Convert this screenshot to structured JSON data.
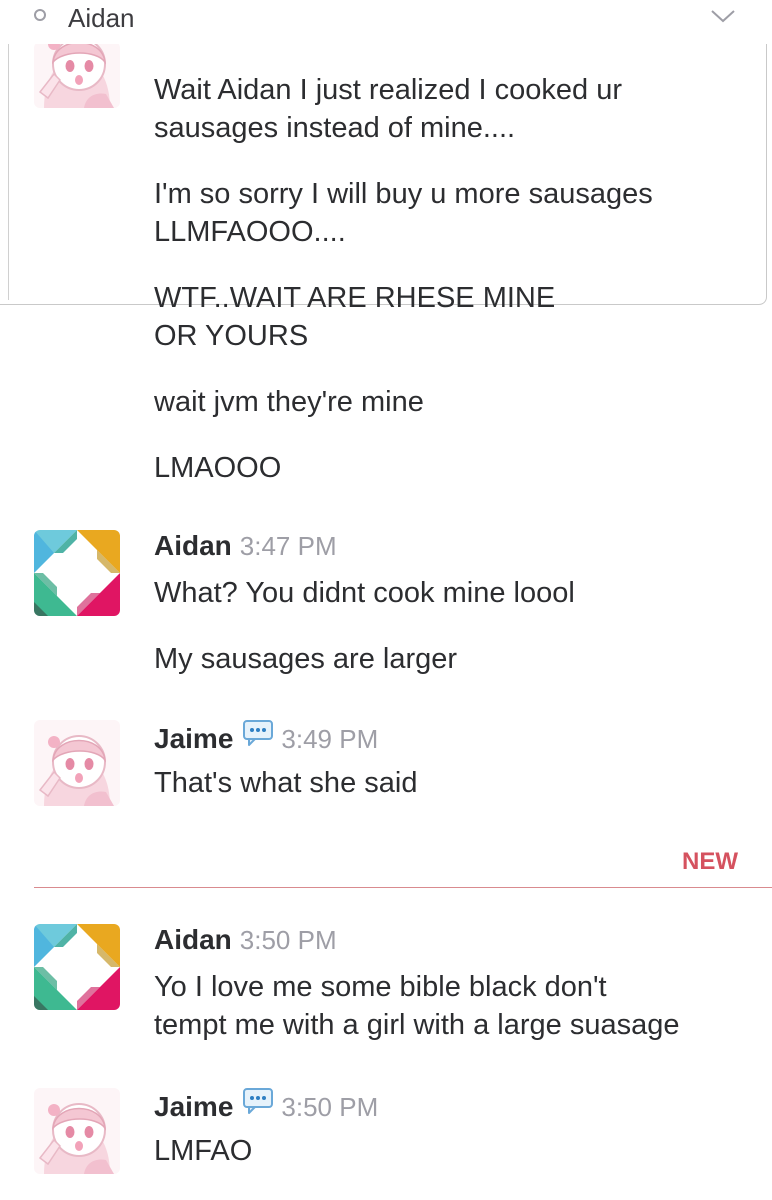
{
  "header": {
    "channel_name": "Aidan",
    "presence_icon": "circle-outline-icon",
    "menu_icon": "chevron-down-icon"
  },
  "messages": [
    {
      "author": "",
      "time": "",
      "avatar": "anime-avatar",
      "lines": [
        "Wait Aidan I just realized I cooked ur",
        "sausages instead of mine....",
        "I'm so sorry I will buy u more sausages",
        "LLMFAOOO....",
        "WTF..WAIT ARE RHESE MINE",
        "OR YOURS",
        "wait jvm they're mine",
        "LMAOOO"
      ]
    },
    {
      "author": "Aidan",
      "time": "3:47 PM",
      "avatar": "slack-logo-avatar",
      "lines": [
        "What? You didnt cook mine loool",
        "My sausages are larger"
      ]
    },
    {
      "author": "Jaime",
      "time": "3:49 PM",
      "avatar": "anime-avatar",
      "status_icon": "speech-bubble-icon",
      "lines": [
        "That's what she said"
      ]
    },
    {
      "author": "Aidan",
      "time": "3:50 PM",
      "avatar": "slack-logo-avatar",
      "lines": [
        "Yo I love me some bible black don't",
        "tempt me with a girl with a large suasage"
      ]
    },
    {
      "author": "Jaime",
      "time": "3:50 PM",
      "avatar": "anime-avatar",
      "status_icon": "speech-bubble-icon",
      "lines": [
        "LMFAO"
      ]
    }
  ],
  "new_divider": {
    "label": "NEW",
    "color": "#d5525f"
  },
  "colors": {
    "slack_teal": "#36c5ab",
    "slack_green": "#3eb991",
    "slack_yellow": "#e9a820",
    "slack_pink": "#e01563",
    "slack_blue": "#6ecadc",
    "timestamp": "#9e9ea6"
  }
}
